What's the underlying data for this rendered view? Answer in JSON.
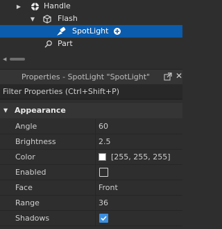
{
  "explorer": {
    "items": [
      {
        "label": "Handle",
        "icon": "part-globe-icon",
        "expanded": false
      },
      {
        "label": "Flash",
        "icon": "model-cube-icon",
        "expanded": true
      },
      {
        "label": "SpotLight",
        "icon": "spotlight-icon",
        "selected": true
      },
      {
        "label": "Part",
        "icon": "pin-icon"
      }
    ]
  },
  "properties": {
    "title": "Properties - SpotLight \"SpotLight\"",
    "filter_placeholder": "Filter Properties (Ctrl+Shift+P)",
    "section": "Appearance",
    "rows": [
      {
        "name": "Angle",
        "value": "60"
      },
      {
        "name": "Brightness",
        "value": "2.5"
      },
      {
        "name": "Color",
        "value": "[255, 255, 255]",
        "color": "#ffffff"
      },
      {
        "name": "Enabled",
        "checked": false
      },
      {
        "name": "Face",
        "value": "Front"
      },
      {
        "name": "Range",
        "value": "36"
      },
      {
        "name": "Shadows",
        "checked": true
      }
    ]
  },
  "colors": {
    "selection": "#0b5cad",
    "checkbox_on": "#3b8fe0",
    "background": "#2e2e2e"
  }
}
